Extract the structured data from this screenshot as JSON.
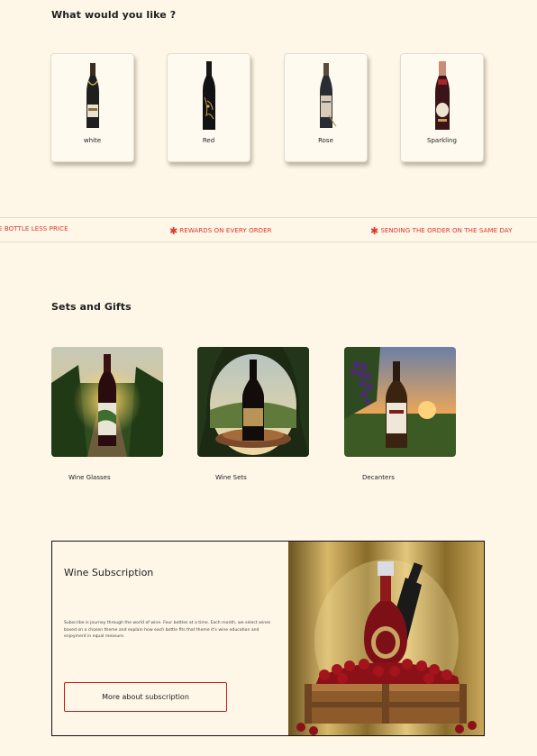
{
  "sections": {
    "categories_title": "What would you like ?",
    "sets_title": "Sets and Gifts"
  },
  "categories": [
    {
      "label": "white",
      "icon": "white-wine-bottle-icon"
    },
    {
      "label": "Red",
      "icon": "red-wine-bottle-icon"
    },
    {
      "label": "Rose",
      "icon": "rose-wine-bottle-icon"
    },
    {
      "label": "Sparkling",
      "icon": "sparkling-wine-bottle-icon"
    }
  ],
  "marquee": {
    "items": [
      "E BOTTLE LESS PRICE",
      "REWARDS ON EVERY ORDER",
      "SENDING THE ORDER ON THE SAME DAY"
    ],
    "star": "✱",
    "color": "#e0342a"
  },
  "gifts": [
    {
      "label": "Wine Glasses"
    },
    {
      "label": "Wine Sets"
    },
    {
      "label": "Decanters"
    }
  ],
  "subscription": {
    "title": "Wine Subscription",
    "description": "Subscribe is journey through the world of wine. Four bottles at a time. Each month, we select wines based on a chosen theme and explain how each bottle fits that theme it's wine education and enjoyment in equal measure.",
    "button_label": "More about subscription",
    "button_border_color": "#c21d1d"
  },
  "colors": {
    "background": "#fef7e8",
    "accent": "#e0342a"
  }
}
